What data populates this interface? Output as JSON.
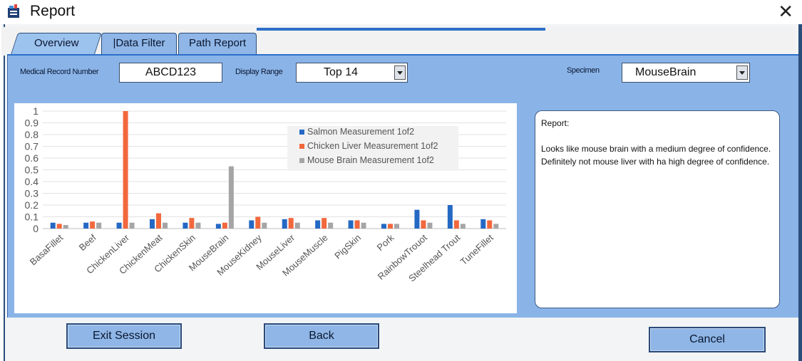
{
  "window": {
    "title": "Report",
    "close_glyph": "✕"
  },
  "tabs": [
    {
      "label": "Overview",
      "active": true
    },
    {
      "label": "|Data Filter",
      "active": false
    },
    {
      "label": "Path Report",
      "active": false
    }
  ],
  "fields": {
    "record_label": "Medical Record Number",
    "record_value": "ABCD123",
    "range_label": "Display Range",
    "range_value": "Top 14",
    "specimen_label": "Specimen",
    "specimen_value": "MouseBrain"
  },
  "report": {
    "title": "Report:",
    "line1": "Looks like mouse brain with a medium degree of confidence.",
    "line2": "Definitely not mouse liver with ha high degree of confidence."
  },
  "buttons": {
    "exit": "Exit Session",
    "back": "Back",
    "cancel": "Cancel"
  },
  "colors": {
    "salmon": "#2469c4",
    "chicken_liver": "#f2683d",
    "mouse_brain": "#a5a5a5",
    "panel": "#8ab4e8"
  },
  "icons": {
    "app": "app-report-icon",
    "close": "close-icon",
    "dropdown": "chevron-down-icon"
  },
  "chart_data": {
    "type": "bar",
    "categories": [
      "BasaFillet",
      "Beef",
      "ChickenLiver",
      "ChickenMeat",
      "ChickenSkin",
      "MouseBrain",
      "MouseKidney",
      "MouseLiver",
      "MouseMuscle",
      "PigSkin",
      "Pork",
      "RainbowTrouot",
      "Steelhead Trout",
      "TuneFillet"
    ],
    "series": [
      {
        "name": "Salmon Measurement 1of2",
        "values": [
          0.05,
          0.05,
          0.05,
          0.08,
          0.05,
          0.04,
          0.07,
          0.08,
          0.07,
          0.07,
          0.04,
          0.16,
          0.2,
          0.08
        ]
      },
      {
        "name": "Chicken Liver Measurement 1of2",
        "values": [
          0.04,
          0.06,
          1.0,
          0.13,
          0.09,
          0.05,
          0.1,
          0.09,
          0.09,
          0.07,
          0.04,
          0.07,
          0.07,
          0.07
        ]
      },
      {
        "name": "Mouse Brain Measurement 1of2",
        "values": [
          0.03,
          0.05,
          0.05,
          0.05,
          0.05,
          0.53,
          0.05,
          0.05,
          0.05,
          0.05,
          0.04,
          0.05,
          0.04,
          0.04
        ]
      }
    ],
    "y_ticks": [
      "0",
      "0.1",
      "0.2",
      "0.3",
      "0.4",
      "0.5",
      "0.6",
      "0.7",
      "0.8",
      "0.9",
      "1"
    ],
    "ylim": [
      0,
      1
    ],
    "grid": true,
    "legend_position": "top-right"
  }
}
